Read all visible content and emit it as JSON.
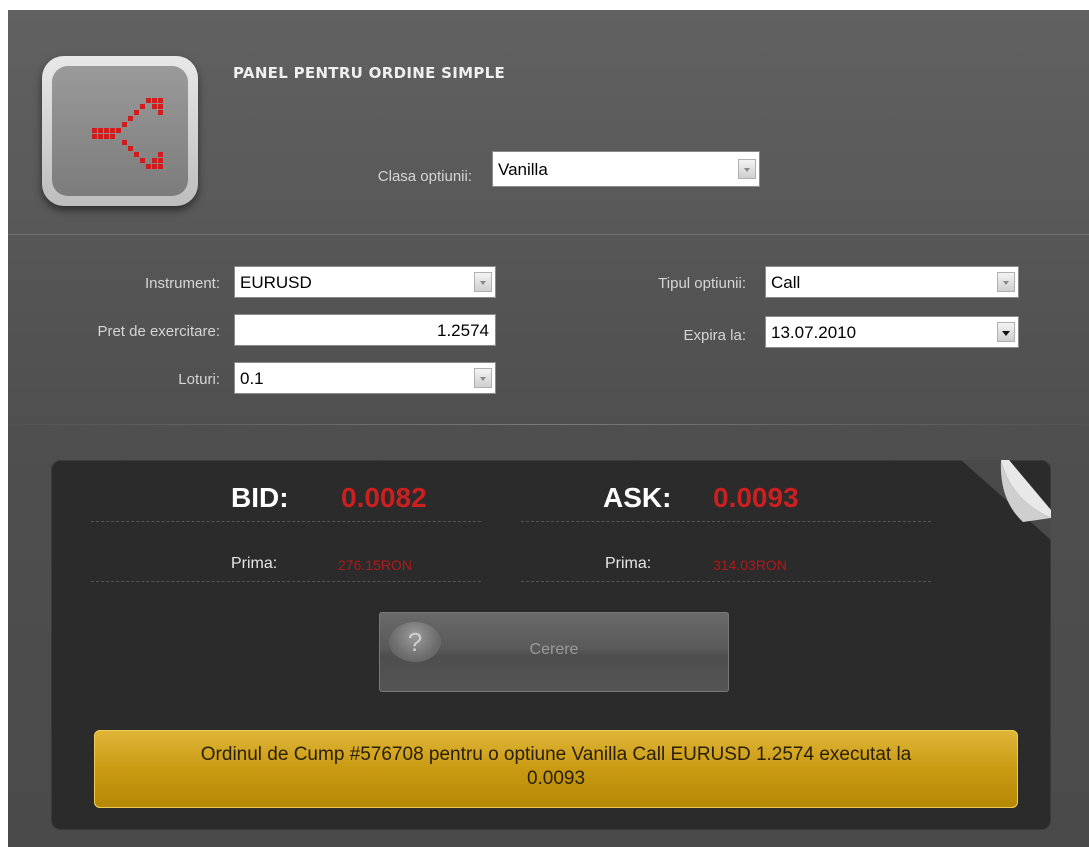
{
  "panel": {
    "title": "PANEL PENTRU ORDINE SIMPLE",
    "accent_color": "#cc1f1f",
    "logo_icon": "split-arrows-icon"
  },
  "option_class": {
    "label": "Clasa optiunii:",
    "value": "Vanilla"
  },
  "form": {
    "instrument": {
      "label": "Instrument:",
      "value": "EURUSD"
    },
    "strike_price": {
      "label": "Pret de exercitare:",
      "value": "1.2574"
    },
    "lots": {
      "label": "Loturi:",
      "value": "0.1"
    },
    "option_type": {
      "label": "Tipul optiunii:",
      "value": "Call"
    },
    "expiry": {
      "label": "Expira la:",
      "value": "13.07.2010"
    }
  },
  "quote": {
    "bid_label": "BID:",
    "bid_value": "0.0082",
    "ask_label": "ASK:",
    "ask_value": "0.0093",
    "bid_premium_label": "Prima:",
    "bid_premium_value": "276.15RON",
    "ask_premium_label": "Prima:",
    "ask_premium_value": "314.03RON",
    "request_button": "Cerere",
    "request_icon": "question-icon"
  },
  "notice": {
    "line1": "Ordinul de Cump #576708 pentru o optiune Vanilla Call EURUSD 1.2574 executat la",
    "line2": "0.0093",
    "color": "#c99a12"
  }
}
